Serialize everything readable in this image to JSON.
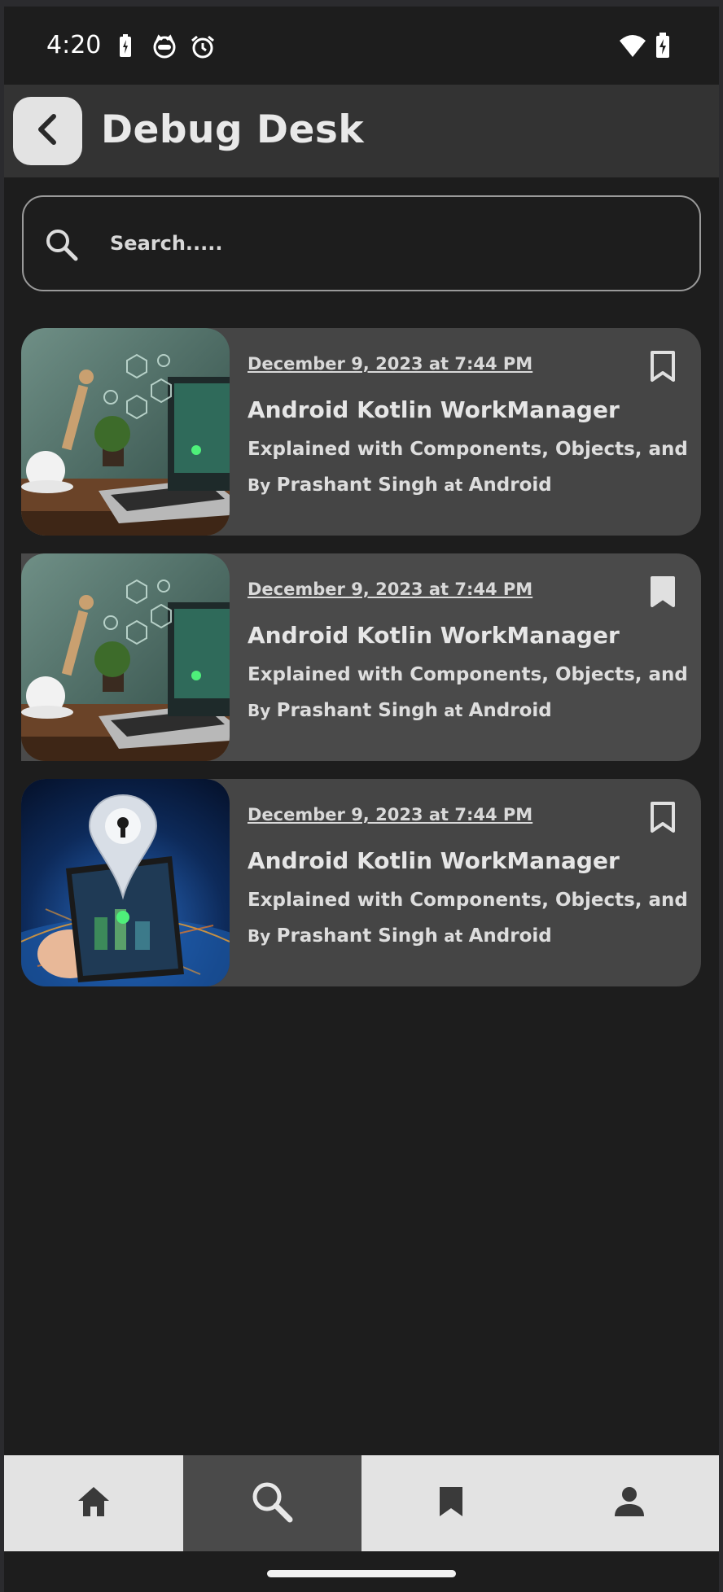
{
  "status_bar": {
    "time": "4:20",
    "icons": [
      "battery-saver-icon",
      "cat-face-icon",
      "alarm-icon",
      "wifi-icon",
      "battery-charging-icon"
    ]
  },
  "app_bar": {
    "title": "Debug Desk",
    "back_icon": "chevron-left-icon"
  },
  "search": {
    "placeholder": "Search.....",
    "value": "",
    "icon": "search-icon"
  },
  "articles": [
    {
      "date": "December 9, 2023 at 7:44 PM",
      "title": "Android Kotlin WorkManager",
      "subtitle": "Explained with Components, Objects, and",
      "by_label": "By",
      "author": "Prashant Singh",
      "at_label": "at",
      "category": "Android",
      "bookmarked": false,
      "image": "workspace-laptop-image"
    },
    {
      "date": "December 9, 2023 at 7:44 PM",
      "title": "Android Kotlin WorkManager",
      "subtitle": "Explained with Components, Objects, and",
      "by_label": "By",
      "author": "Prashant Singh",
      "at_label": "at",
      "category": "Android",
      "bookmarked": true,
      "image": "workspace-laptop-image"
    },
    {
      "date": "December 9, 2023 at 7:44 PM",
      "title": "Android Kotlin WorkManager",
      "subtitle": "Explained with Components, Objects, and",
      "by_label": "By",
      "author": "Prashant Singh",
      "at_label": "at",
      "category": "Android",
      "bookmarked": false,
      "image": "phone-location-pin-image"
    }
  ],
  "bottom_nav": {
    "items": [
      {
        "icon": "home-icon",
        "active": false
      },
      {
        "icon": "search-icon",
        "active": true
      },
      {
        "icon": "bookmark-icon",
        "active": false
      },
      {
        "icon": "person-icon",
        "active": false
      }
    ]
  },
  "colors": {
    "background": "#1d1d1d",
    "app_bar": "#333333",
    "card": "#454545",
    "nav_bar": "#e3e3e3",
    "nav_active": "#4a4a4a"
  }
}
